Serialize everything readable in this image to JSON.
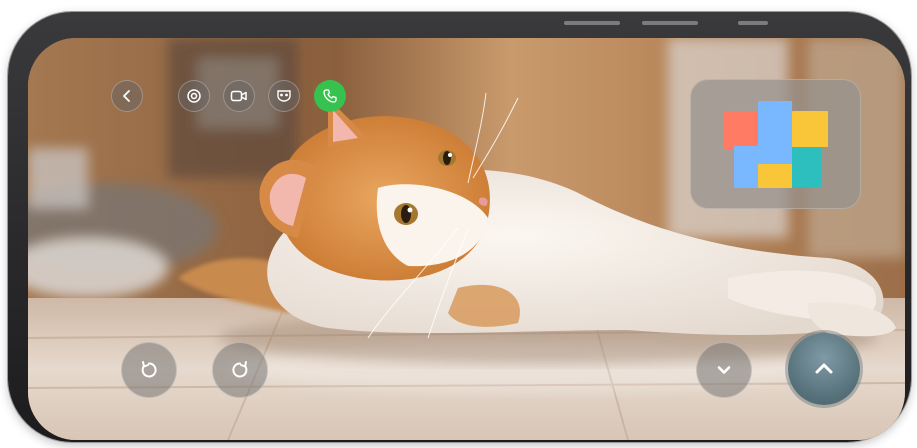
{
  "window": {
    "scene": "cat-lying-on-tile-floor"
  },
  "top_toolbar": {
    "buttons": [
      {
        "id": "back",
        "icon": "chevron-left-icon"
      },
      {
        "id": "snapshot",
        "icon": "camera-lens-icon"
      },
      {
        "id": "record",
        "icon": "video-camera-icon"
      },
      {
        "id": "mask",
        "icon": "mask-icon"
      },
      {
        "id": "call",
        "icon": "phone-icon",
        "color": "#37c24f"
      }
    ]
  },
  "minimap": {
    "rooms": [
      {
        "name": "room-red",
        "color": "#ff7b63"
      },
      {
        "name": "room-blue",
        "color": "#79b7ff"
      },
      {
        "name": "room-yellow-top",
        "color": "#f9c63a"
      },
      {
        "name": "room-yellow-bottom",
        "color": "#f9c63a"
      },
      {
        "name": "room-teal",
        "color": "#2cbfbd"
      }
    ]
  },
  "controls": {
    "rotate_left": {
      "icon": "rotate-counterclockwise-icon"
    },
    "rotate_right": {
      "icon": "rotate-clockwise-icon"
    },
    "move_down": {
      "icon": "chevron-down-icon"
    },
    "move_up": {
      "icon": "chevron-up-icon",
      "active": true
    }
  },
  "colors": {
    "call_green": "#37c24f",
    "up_button": "#5f7c87",
    "phone_frame": "#2a2a2c"
  }
}
